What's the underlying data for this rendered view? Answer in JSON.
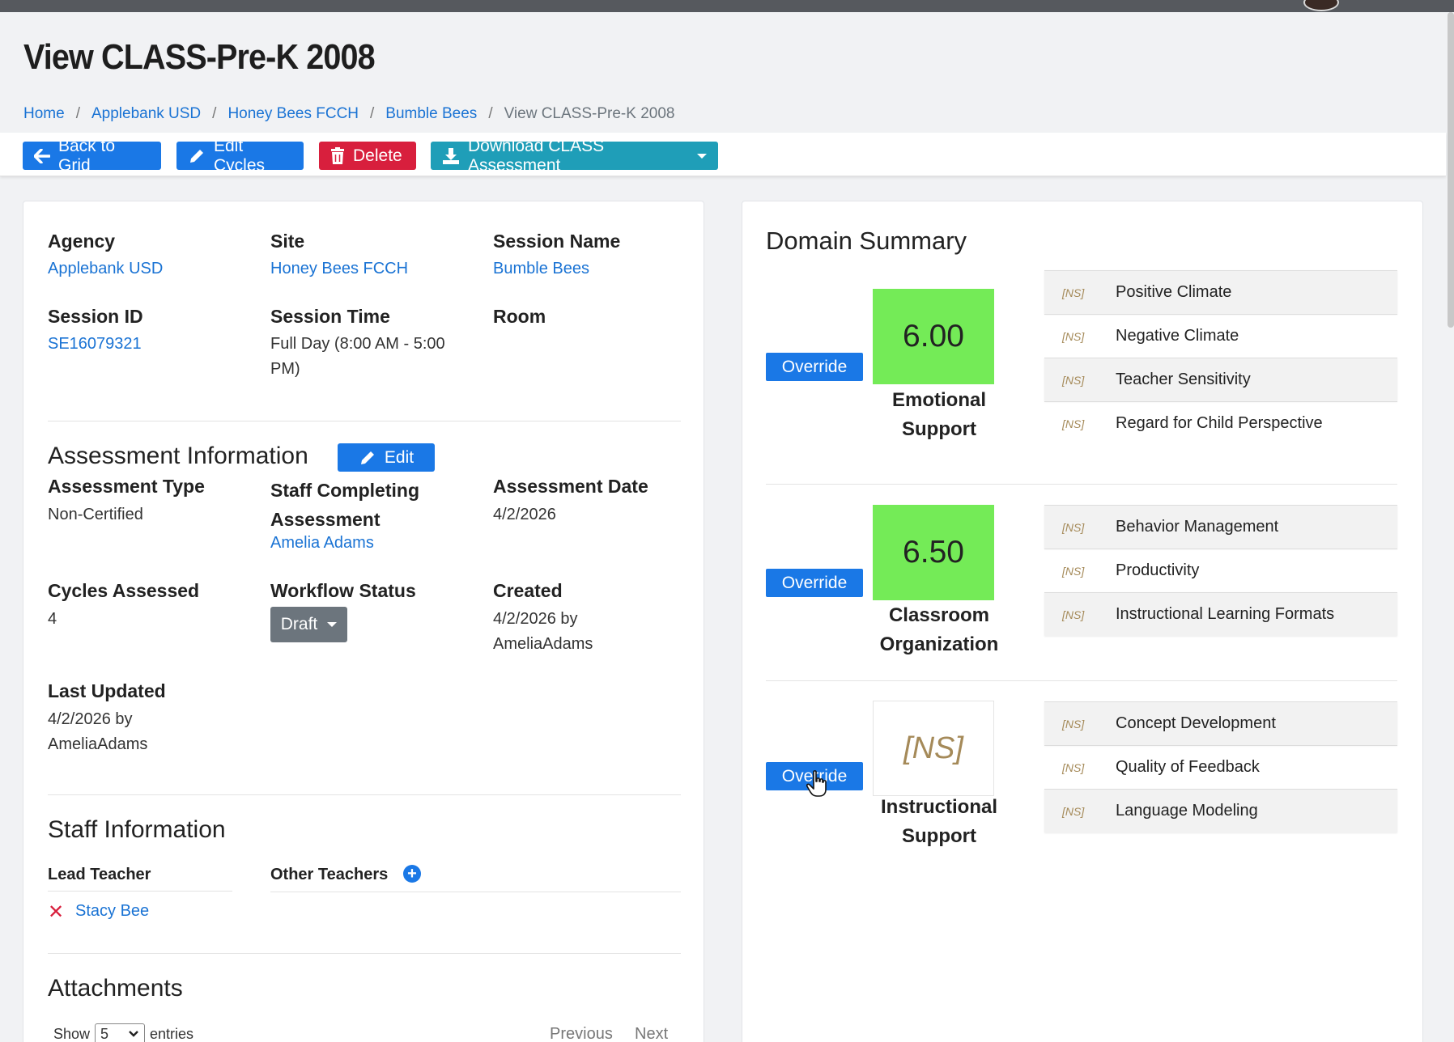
{
  "page": {
    "title": "View CLASS-Pre-K 2008"
  },
  "breadcrumb": [
    "Home",
    "Applebank USD",
    "Honey Bees FCCH",
    "Bumble Bees",
    "View CLASS-Pre-K 2008"
  ],
  "toolbar": {
    "back_label": "Back to Grid",
    "edit_cycles_label": "Edit Cycles",
    "delete_label": "Delete",
    "download_label": "Download CLASS Assessment"
  },
  "info": {
    "agency_label": "Agency",
    "agency_value": "Applebank USD",
    "site_label": "Site",
    "site_value": "Honey Bees FCCH",
    "session_name_label": "Session Name",
    "session_name_value": "Bumble Bees",
    "session_id_label": "Session ID",
    "session_id_value": "SE16079321",
    "session_time_label": "Session Time",
    "session_time_line1": "Full Day (8:00 AM - 5:00",
    "session_time_line2": "PM)",
    "room_label": "Room"
  },
  "assessment": {
    "title": "Assessment Information",
    "edit_label": "Edit",
    "type_label": "Assessment Type",
    "type_value": "Non-Certified",
    "staff_label_line1": "Staff Completing",
    "staff_label_line2": "Assessment",
    "staff_value": "Amelia Adams",
    "date_label": "Assessment Date",
    "date_value": "4/2/2026",
    "cycles_label": "Cycles Assessed",
    "cycles_value": "4",
    "workflow_label": "Workflow Status",
    "workflow_value": "Draft",
    "created_label": "Created",
    "created_line1": "4/2/2026 by",
    "created_line2": "AmeliaAdams",
    "updated_label": "Last Updated",
    "updated_line1": "4/2/2026 by",
    "updated_line2": "AmeliaAdams"
  },
  "staff": {
    "title": "Staff Information",
    "lead_label": "Lead Teacher",
    "other_label": "Other Teachers",
    "lead_value": "Stacy Bee"
  },
  "attachments": {
    "title": "Attachments",
    "show_label": "Show",
    "show_value": "5",
    "entries_label": "entries",
    "previous_label": "Previous",
    "next_label": "Next"
  },
  "domain_summary": {
    "title": "Domain Summary",
    "override_label": "Override",
    "domains": [
      {
        "score": "6.00",
        "name_line1": "Emotional",
        "name_line2": "Support",
        "dimensions": [
          {
            "ns": "[NS]",
            "label": "Positive Climate"
          },
          {
            "ns": "[NS]",
            "label": "Negative Climate"
          },
          {
            "ns": "[NS]",
            "label": "Teacher Sensitivity"
          },
          {
            "ns": "[NS]",
            "label": "Regard for Child Perspective"
          }
        ]
      },
      {
        "score": "6.50",
        "name_line1": "Classroom",
        "name_line2": "Organization",
        "dimensions": [
          {
            "ns": "[NS]",
            "label": "Behavior Management"
          },
          {
            "ns": "[NS]",
            "label": "Productivity"
          },
          {
            "ns": "[NS]",
            "label": "Instructional Learning Formats"
          }
        ]
      },
      {
        "score": "[NS]",
        "name_line1": "Instructional",
        "name_line2": "Support",
        "dimensions": [
          {
            "ns": "[NS]",
            "label": "Concept Development"
          },
          {
            "ns": "[NS]",
            "label": "Quality of Feedback"
          },
          {
            "ns": "[NS]",
            "label": "Language Modeling"
          }
        ]
      }
    ]
  },
  "colors": {
    "primary": "#1a78e6",
    "danger": "#d81f3d",
    "info": "#1f9eb8",
    "score_green": "#74eb57",
    "ns_gold": "#a58a59"
  }
}
